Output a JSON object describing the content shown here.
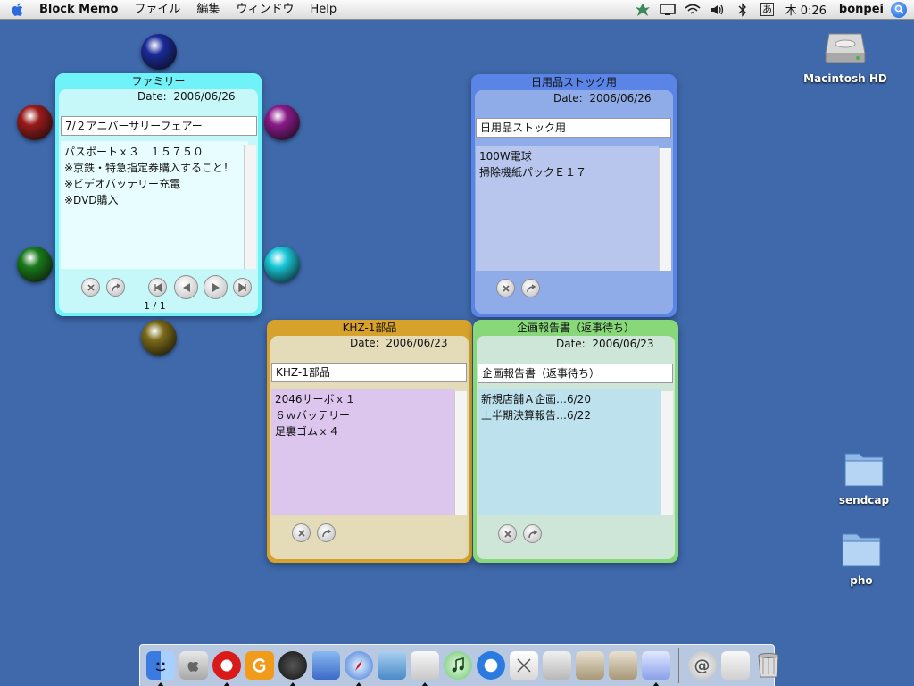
{
  "menubar": {
    "app_name": "Block Memo",
    "items": [
      "ファイル",
      "編集",
      "ウィンドウ",
      "Help"
    ],
    "input_indicator": "あ",
    "clock": "木 0:26",
    "user": "bonpei"
  },
  "memos": [
    {
      "title": "ファミリー",
      "date_label": "Date:",
      "date": "2006/06/26",
      "subject": "7/２アニバーサリーフェアー",
      "body": "パスポートｘ３　１５７５０\n※京鉄・特急指定券購入すること！\n※ビデオバッテリー充電\n※DVD購入",
      "pager": "1 / 1",
      "colors": {
        "frame": "#6ff3f8",
        "inner": "#c6f8fa",
        "body": "#e8fdff"
      }
    },
    {
      "title": "日用品ストック用",
      "date_label": "Date:",
      "date": "2006/06/26",
      "subject": "日用品ストック用",
      "body": "100W電球\n掃除機紙パックＥ１７",
      "colors": {
        "frame": "#5a84e6",
        "inner": "#90ace8",
        "body": "#b8c6ee"
      }
    },
    {
      "title": "KHZ-1部品",
      "date_label": "Date:",
      "date": "2006/06/23",
      "subject": "KHZ-1部品",
      "body": "2046サーボｘ１\n６ｗバッテリー\n足裏ゴムｘ４",
      "colors": {
        "frame": "#d6a22c",
        "inner": "#e4dcb8",
        "body": "#dcc6ee"
      }
    },
    {
      "title": "企画報告書（返事待ち）",
      "date_label": "Date:",
      "date": "2006/06/23",
      "subject": "企画報告書（返事待ち）",
      "body": "新規店舗Ａ企画…6/20\n上半期決算報告…6/22",
      "colors": {
        "frame": "#88d87a",
        "inner": "#cde6d8",
        "body": "#bde2ee"
      }
    }
  ],
  "desktop": {
    "icons": [
      {
        "label": "Macintosh HD",
        "icon": "hard-drive-icon"
      },
      {
        "label": "sendcap",
        "icon": "folder-icon"
      },
      {
        "label": "pho",
        "icon": "folder-icon"
      }
    ]
  },
  "orb_colors": [
    "#1a2a9a",
    "#9a1a1a",
    "#8a1a8a",
    "#1a7a1a",
    "#18c8d8",
    "#7a6a18"
  ],
  "dock": {
    "items": [
      "finder-icon",
      "system-prefs-icon",
      "opera-icon",
      "g-app-icon",
      "dashboard-icon",
      "mail-icon",
      "safari-icon",
      "preview-icon",
      "textedit-icon",
      "itunes-icon",
      "quicktime-icon",
      "block-memo-icon",
      "script-editor-icon",
      "home-folder-icon",
      "apps-folder-icon",
      "sendcap-icon",
      "mail-at-icon",
      "photo-icon",
      "trash-icon"
    ]
  }
}
